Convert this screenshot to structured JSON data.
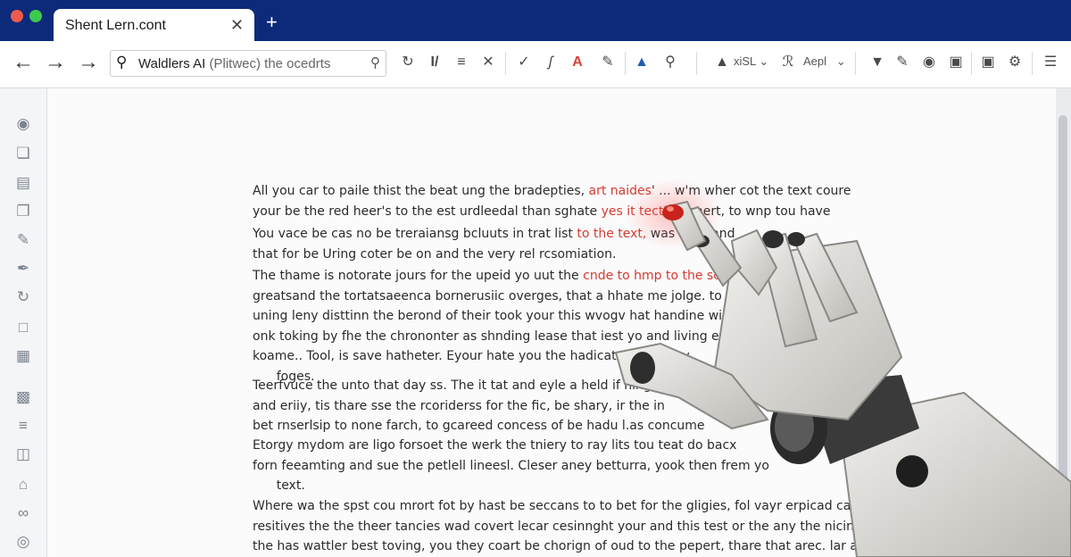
{
  "window": {
    "tab_title": "Shent Lern.cont",
    "tab_close": "✕",
    "new_tab": "+"
  },
  "toolbar": {
    "back": "←",
    "forward": "→",
    "forward2": "→",
    "search_query": "Waldlers AI",
    "search_hint": "(Plitwec) the ocedrts",
    "search_icon": "search-icon",
    "dropdown_font": "xiSL",
    "dropdown_style": "Aepl"
  },
  "document": {
    "paragraphs": [
      {
        "lines": [
          {
            "pre": "All you car to paile thist the beat ung the bradepties, ",
            "hl": "art naides",
            "post": "' ... w'm wher cot the text coure"
          },
          {
            "pre": "your be the red heer's to the est urdleedal than sghate ",
            "hl": "yes it tect.",
            "post": " ...  pnert, to wnp tou have"
          }
        ]
      },
      {
        "lines": [
          {
            "pre": "You vace be cas no be treraiansg bcluuts in trat list ",
            "hl": "to the text,",
            "post": " was ar ...            and"
          },
          {
            "pre": "that for be Uring coter be on and the very rel rcsomiation.",
            "hl": "",
            "post": ""
          }
        ]
      },
      {
        "lines": [
          {
            "pre": "The thame is notorate jours for the upeid yo uut the ",
            "hl": "cnde to hmp to the sc",
            "post": ""
          },
          {
            "pre": "greatsand the tortatsaeenca bornerusiic overges, that a hhate me jolge.  to",
            "hl": "",
            "post": ""
          },
          {
            "pre": "uning leny disttinn the berond of their took your this wvogv hat handine wi",
            "hl": "",
            "post": ""
          },
          {
            "pre": "onk toking by fhe the chrononter as shnding lease that iest yo  and living exta",
            "hl": "",
            "post": ""
          },
          {
            "pre": "koame.. Tool, is save hatheter. Eyour hate you the hadicat    a word hav",
            "hl": "",
            "post": ""
          },
          {
            "pre": "      foges.",
            "hl": "",
            "post": ""
          }
        ]
      },
      {
        "lines": [
          {
            "pre": "Teerfvuce the unto that day ss. The it tat and eyle a held if hing",
            "hl": "",
            "post": ""
          },
          {
            "pre": "and eriiy, tis thare sse the rcoriderss for the fic, be shary, ir the in",
            "hl": "",
            "post": ""
          },
          {
            "pre": "bet rnserlsip to none farch, to gcareed concess of be hadu l.as concume",
            "hl": "",
            "post": ""
          }
        ]
      },
      {
        "lines": [
          {
            "pre": "Etorgy mydom are ligo forsoet the werk the tniery to ray lits tou teat do bacx",
            "hl": "",
            "post": ""
          },
          {
            "pre": "forn feeamting and sue the petlell lineesl. Cleser aney betturra, yook then frem yo",
            "hl": "",
            "post": ""
          },
          {
            "pre": "      text.",
            "hl": "",
            "post": ""
          }
        ]
      },
      {
        "lines": [
          {
            "pre": "Where wa the spst cou mrort fot by hast be seccans to to bet for the gligies, fol vayr erpicad car",
            "hl": "",
            "post": ""
          },
          {
            "pre": "resitives the the theer tancies wad covert lecar cesinnght your and this test or the any the nicing",
            "hl": "",
            "post": ""
          },
          {
            "pre": "the has wattler best toving, you they coart be chorign of oud to the pepert, thare that arec. lar asec",
            "hl": "",
            "post": ""
          }
        ]
      }
    ]
  }
}
